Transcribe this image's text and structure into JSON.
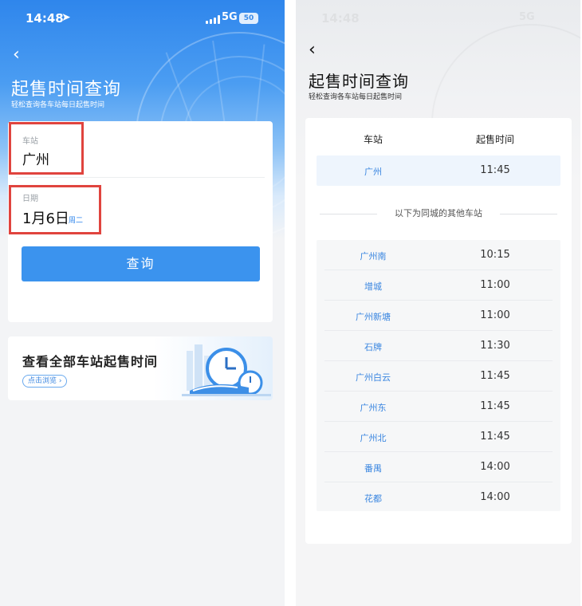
{
  "left": {
    "status": {
      "time": "14:48",
      "network": "5G",
      "battery": "50"
    },
    "title": "起售时间查询",
    "subtitle": "轻松查询各车站每日起售时间",
    "form": {
      "station_label": "车站",
      "station_value": "广州",
      "date_label": "日期",
      "date_value": "1月6日",
      "weekday": "周二",
      "query_button": "查询"
    },
    "promo": {
      "title": "查看全部车站起售时间",
      "link": "点击浏览 ›"
    }
  },
  "right": {
    "title": "起售时间查询",
    "subtitle": "轻松查询各车站每日起售时间",
    "table": {
      "headers": [
        "车站",
        "起售时间"
      ],
      "main": {
        "station": "广州",
        "time": "11:45"
      },
      "other_label": "以下为同城的其他车站",
      "others": [
        {
          "station": "广州南",
          "time": "10:15"
        },
        {
          "station": "增城",
          "time": "11:00"
        },
        {
          "station": "广州新塘",
          "time": "11:00"
        },
        {
          "station": "石牌",
          "time": "11:30"
        },
        {
          "station": "广州白云",
          "time": "11:45"
        },
        {
          "station": "广州东",
          "time": "11:45"
        },
        {
          "station": "广州北",
          "time": "11:45"
        },
        {
          "station": "番禺",
          "time": "14:00"
        },
        {
          "station": "花都",
          "time": "14:00"
        }
      ]
    }
  },
  "colors": {
    "brand_blue": "#3b93ee",
    "highlight_red": "#e0443e",
    "station_text_blue": "#3a86e0"
  }
}
